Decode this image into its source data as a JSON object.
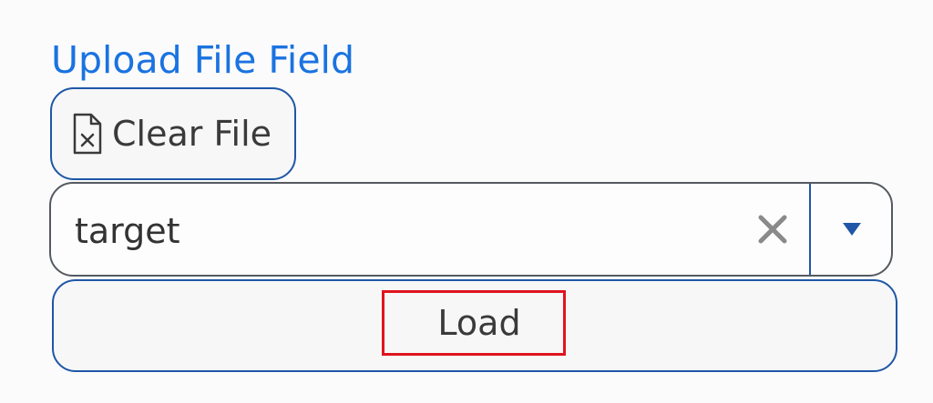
{
  "upload_field": {
    "title": "Upload File Field",
    "clear_button_label": "Clear File",
    "clear_button_icon": "file-x-icon",
    "combo_value": "target",
    "combo_clear_icon": "close-icon",
    "combo_toggle_icon": "caret-down-icon",
    "load_button_label": "Load"
  },
  "colors": {
    "title": "#1a73e0",
    "button_border": "#1f57a6",
    "combo_border": "#555a60",
    "caret": "#1f57a6",
    "clear_x": "#8a8a8a",
    "highlight": "#e0141e"
  }
}
